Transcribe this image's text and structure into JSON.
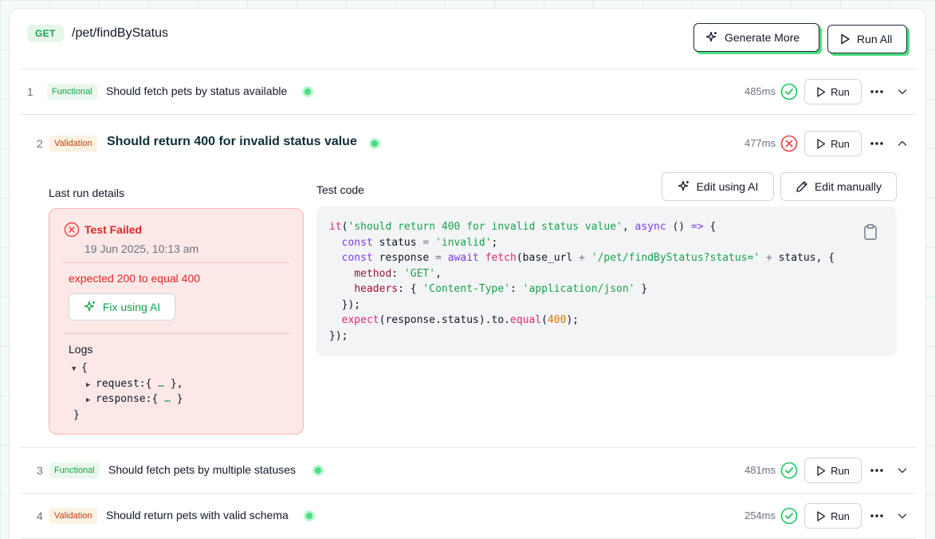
{
  "header": {
    "method": "GET",
    "endpoint": "/pet/findByStatus",
    "generate_more_label": "Generate More",
    "run_all_label": "Run All"
  },
  "tests": [
    {
      "num": "1",
      "tag": "Functional",
      "title": "Should fetch pets by status available",
      "duration": "485ms",
      "status": "passed",
      "run_label": "Run"
    },
    {
      "num": "2",
      "tag": "Validation",
      "title": "Should return 400 for invalid status value",
      "duration": "477ms",
      "status": "failed",
      "run_label": "Run"
    },
    {
      "num": "3",
      "tag": "Functional",
      "title": "Should fetch pets by multiple statuses",
      "duration": "481ms",
      "status": "passed",
      "run_label": "Run"
    },
    {
      "num": "4",
      "tag": "Validation",
      "title": "Should return pets with valid schema",
      "duration": "254ms",
      "status": "passed",
      "run_label": "Run"
    }
  ],
  "details": {
    "last_run_label": "Last run details",
    "test_code_label": "Test code",
    "edit_ai_label": "Edit using AI",
    "edit_manual_label": "Edit manually",
    "fail_title": "Test Failed",
    "fail_time": "19 Jun 2025, 10:13 am",
    "fail_message": "expected 200 to equal 400",
    "fix_label": "Fix using AI",
    "logs_label": "Logs",
    "logs": {
      "open": "{",
      "request_key": "request:",
      "response_key": "response:",
      "ellipsis": "…",
      "close": "}"
    }
  },
  "colors": {
    "accent_green": "#4ade80",
    "pass": "#22c55e",
    "fail": "#ef4444",
    "validation_tag": "#c2410c",
    "functional_tag": "#16a34a"
  }
}
